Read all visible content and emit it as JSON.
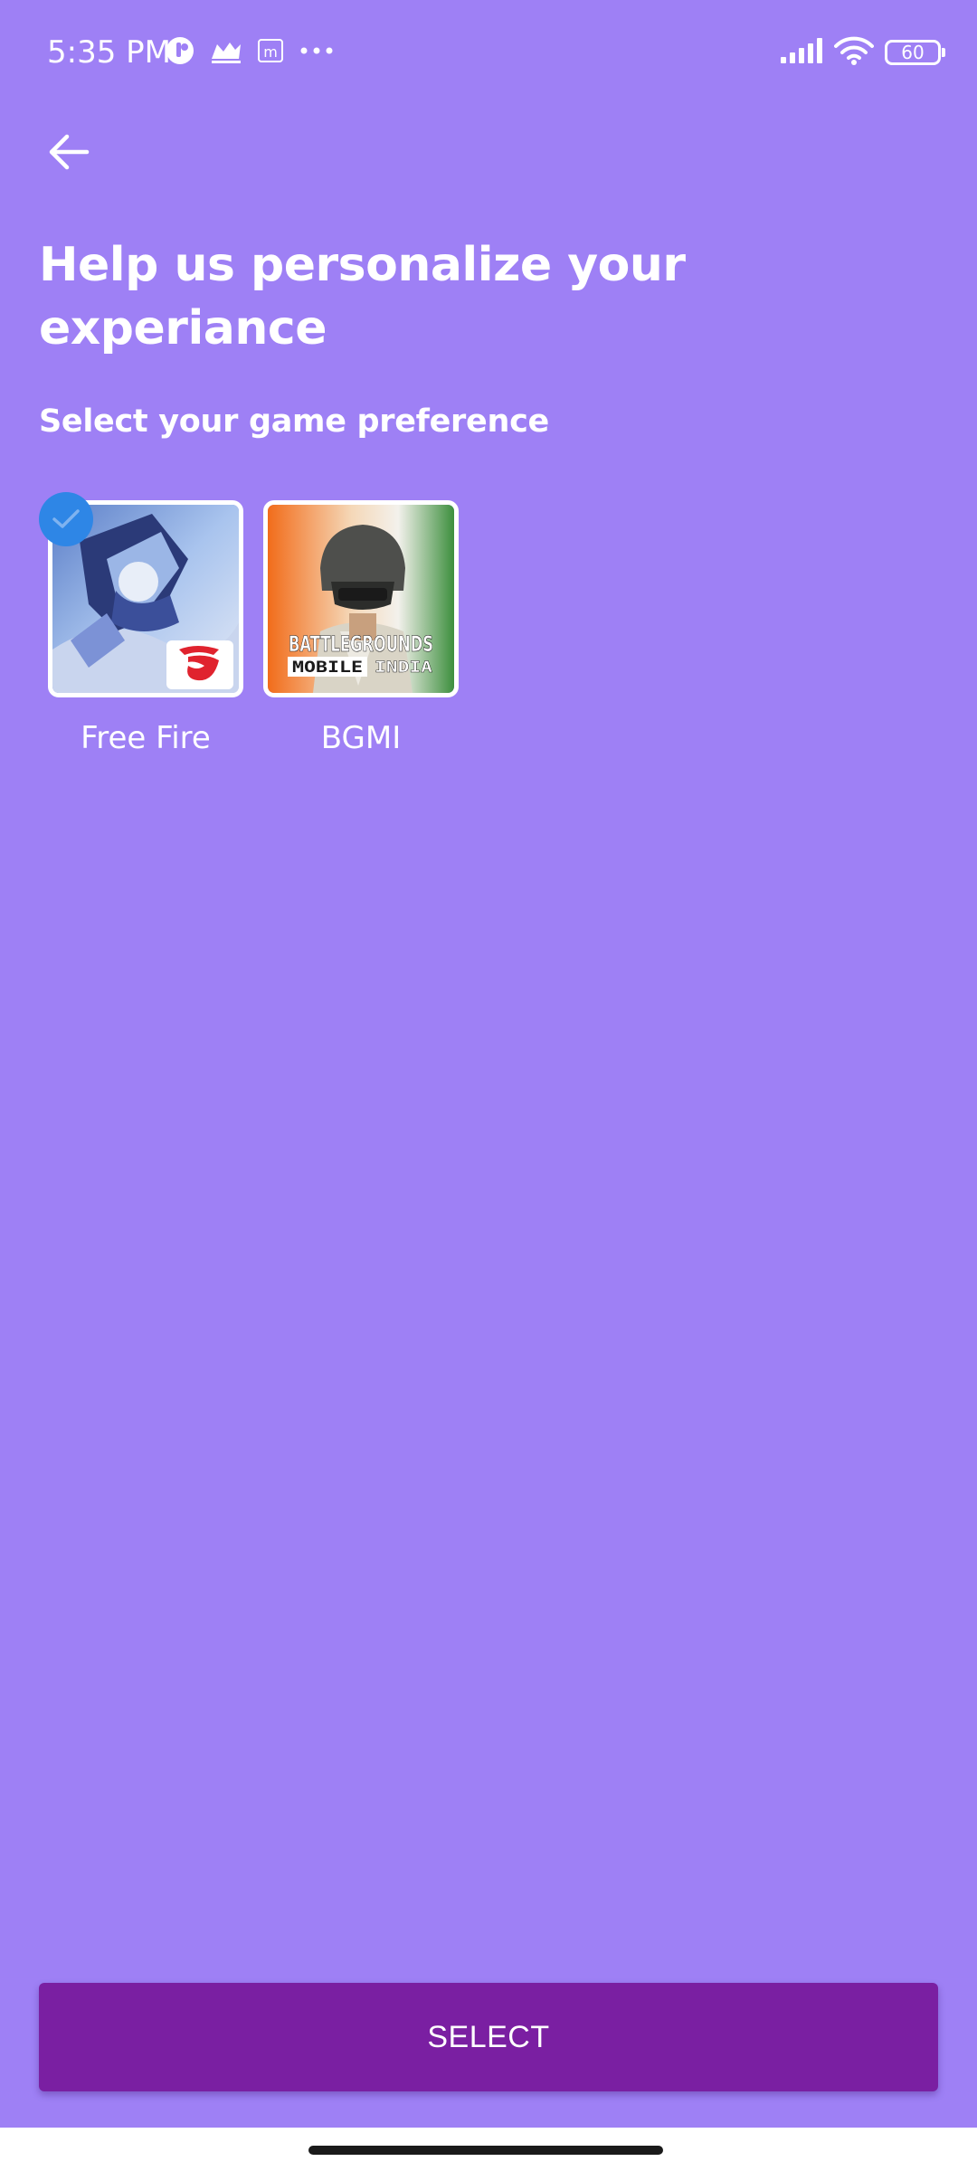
{
  "status_bar": {
    "time": "5:35 PM",
    "battery": "60",
    "left_icons": [
      "app-notification-icon",
      "crown-icon",
      "m-app-icon",
      "more-dots-icon"
    ],
    "right_icons": [
      "signal-icon",
      "wifi-icon",
      "battery-icon"
    ]
  },
  "header": {
    "back_icon": "arrow-back-icon",
    "title": "Help us personalize your experiance"
  },
  "preference": {
    "label": "Select your game preference",
    "games": [
      {
        "name": "Free Fire",
        "selected": true
      },
      {
        "name": "BGMI",
        "selected": false,
        "logo_text_top": "BATTLEGROUNDS",
        "logo_text_bottom_left": "MOBILE",
        "logo_text_bottom_right": "INDIA"
      }
    ]
  },
  "footer": {
    "select_label": "SELECT"
  },
  "colors": {
    "background": "#9E80F5",
    "button": "#7A1FA2",
    "check_badge": "#2E86E6",
    "text": "#FFFFFF"
  }
}
